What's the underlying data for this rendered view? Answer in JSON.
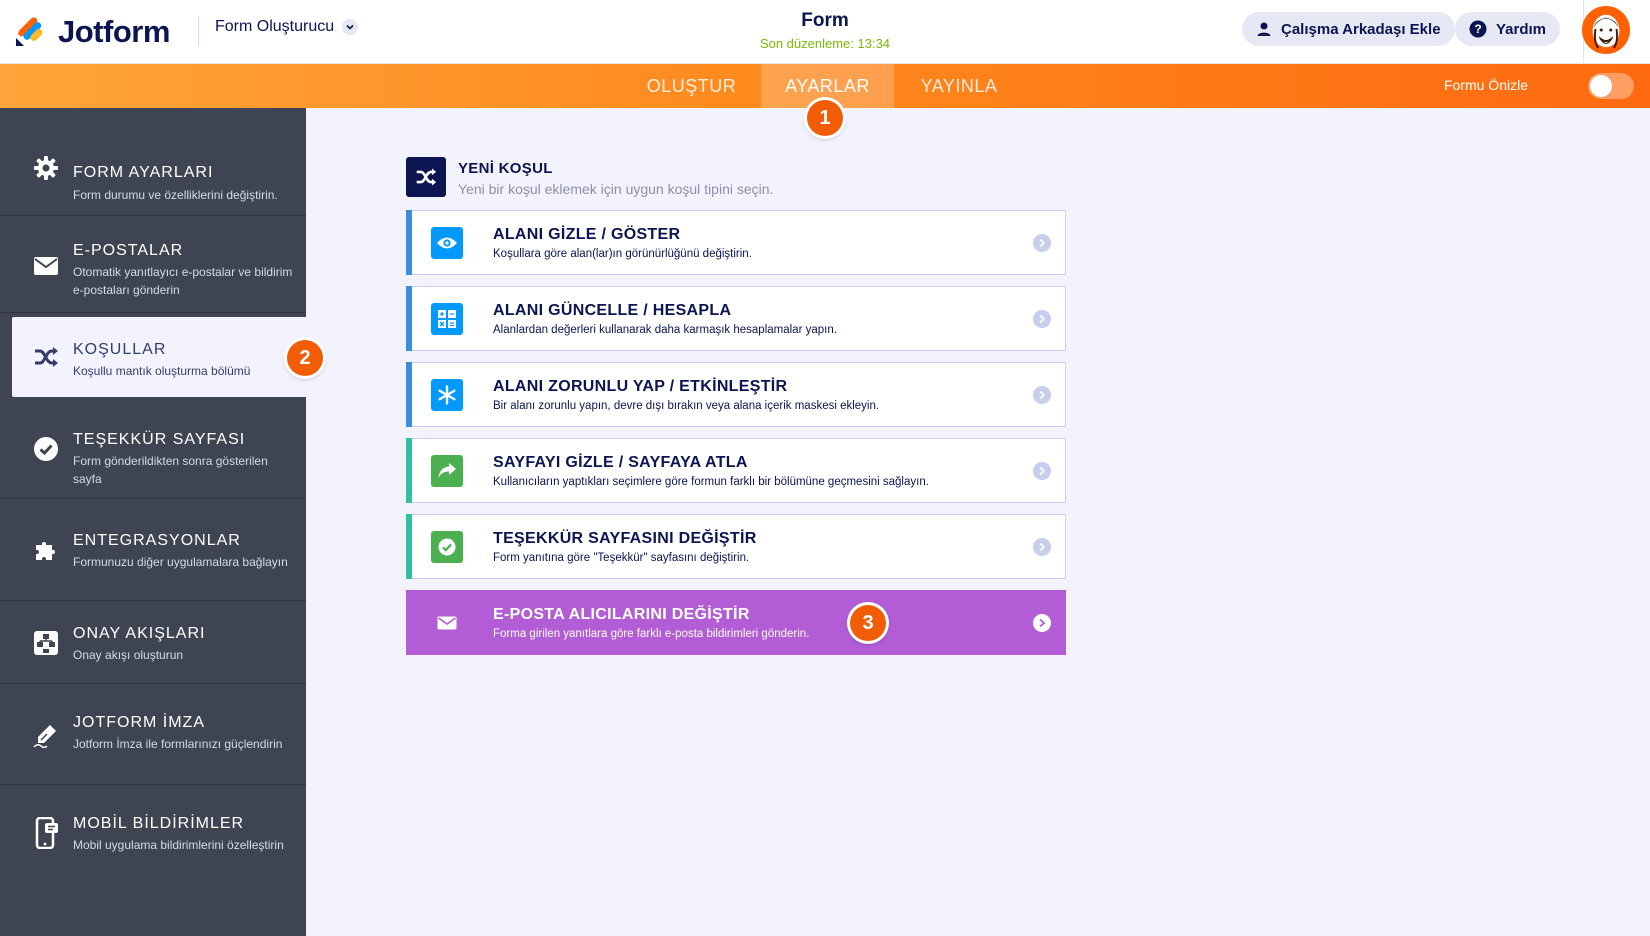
{
  "header": {
    "brand": "Jotform",
    "builder_label": "Form Oluşturucu",
    "form_title": "Form",
    "last_edited": "Son düzenleme: 13:34",
    "add_collaborator": "Çalışma Arkadaşı Ekle",
    "help": "Yardım"
  },
  "nav": {
    "tabs": [
      "OLUŞTUR",
      "AYARLAR",
      "YAYINLA"
    ],
    "active_tab": "AYARLAR",
    "preview_label": "Formu Önizle",
    "preview_on": false
  },
  "badges": [
    "1",
    "2",
    "3"
  ],
  "sidebar": {
    "items": [
      {
        "title": "FORM AYARLARI",
        "desc": "Form durumu ve özelliklerini değiştirin.",
        "icon": "gear-icon"
      },
      {
        "title": "E-POSTALAR",
        "desc": "Otomatik yanıtlayıcı e-postalar ve bildirim e-postaları gönderin",
        "icon": "envelope-icon"
      },
      {
        "title": "KOŞULLAR",
        "desc": "Koşullu mantık oluşturma bölümü",
        "icon": "shuffle-icon"
      },
      {
        "title": "TEŞEKKÜR SAYFASI",
        "desc": "Form gönderildikten sonra gösterilen sayfa",
        "icon": "check-circle-icon"
      },
      {
        "title": "ENTEGRASYONLAR",
        "desc": "Formunuzu diğer uygulamalara bağlayın",
        "icon": "puzzle-icon"
      },
      {
        "title": "ONAY AKIŞLARI",
        "desc": "Onay akışı oluşturun",
        "icon": "flow-icon"
      },
      {
        "title": "JOTFORM İMZA",
        "desc": "Jotform İmza ile formlarınızı güçlendirin",
        "icon": "pen-icon"
      },
      {
        "title": "MOBİL BİLDİRİMLER",
        "desc": "Mobil uygulama bildirimlerini özelleştirin",
        "icon": "mobile-icon"
      }
    ],
    "active_index": 2
  },
  "main": {
    "title": "YENİ KOŞUL",
    "subtitle": "Yeni bir koşul eklemek için uygun koşul tipini seçin.",
    "conditions": [
      {
        "title": "ALANI GİZLE / GÖSTER",
        "desc": "Koşullara göre alan(lar)ın görünürlüğünü değiştirin.",
        "icon": "eye-icon",
        "color": "#0099ff",
        "bar": "#3a8fd9"
      },
      {
        "title": "ALANI GÜNCELLE / HESAPLA",
        "desc": "Alanlardan değerleri kullanarak daha karmaşık hesaplamalar yapın.",
        "icon": "calculator-icon",
        "color": "#0099ff",
        "bar": "#3a8fd9"
      },
      {
        "title": "ALANI ZORUNLU YAP / ETKİNLEŞTİR",
        "desc": "Bir alanı zorunlu yapın, devre dışı bırakın veya alana içerik maskesi ekleyin.",
        "icon": "asterisk-icon",
        "color": "#0099ff",
        "bar": "#3a8fd9"
      },
      {
        "title": "SAYFAYI GİZLE / SAYFAYA ATLA",
        "desc": "Kullanıcıların yaptıkları seçimlere göre formun farklı bir bölümüne geçmesini sağlayın.",
        "icon": "share-arrow-icon",
        "color": "#4caf50",
        "bar": "#2fc2a0"
      },
      {
        "title": "TEŞEKKÜR SAYFASINI DEĞİŞTİR",
        "desc": "Form yanıtına göre \"Teşekkür\" sayfasını değiştirin.",
        "icon": "check-circle-icon",
        "color": "#4caf50",
        "bar": "#2fc2a0"
      },
      {
        "title": "E-POSTA ALICILARINI DEĞİŞTİR",
        "desc": "Forma girilen yanıtlara göre farklı e-posta bildirimleri gönderin.",
        "icon": "envelope-icon",
        "color": "#b25dd5",
        "bar": "#b25dd5"
      }
    ],
    "highlighted_index": 5
  },
  "colors": {
    "navy": "#0a1551",
    "orange": "#ff6100",
    "sidebar_bg": "#3e4452",
    "highlight_purple": "#b25dd5",
    "badge": "#f25c05"
  }
}
